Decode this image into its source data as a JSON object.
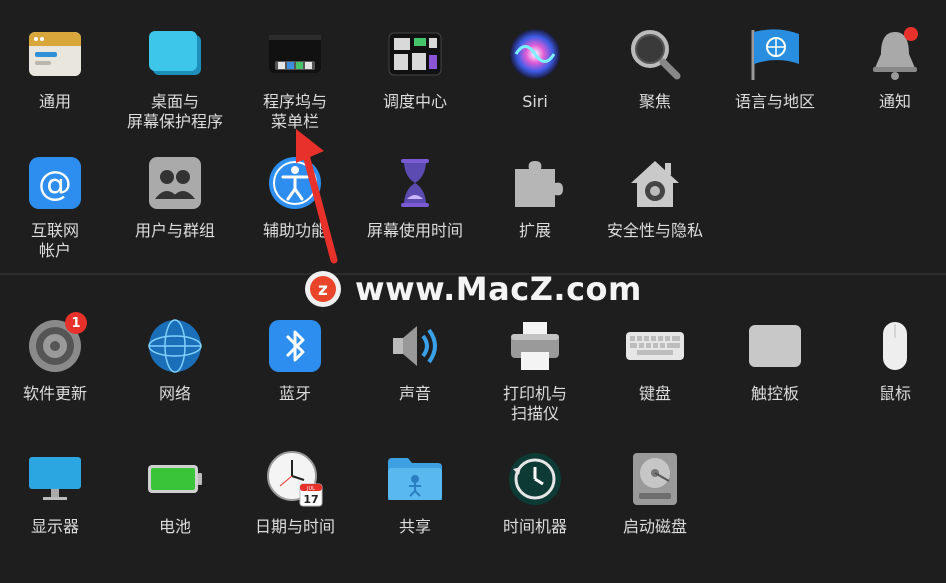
{
  "row1": [
    {
      "label": "通用",
      "icon": "general-icon"
    },
    {
      "label": "桌面与\n屏幕保护程序",
      "icon": "desktop-screensaver-icon"
    },
    {
      "label": "程序坞与\n菜单栏",
      "icon": "dock-menubar-icon"
    },
    {
      "label": "调度中心",
      "icon": "mission-control-icon"
    },
    {
      "label": "Siri",
      "icon": "siri-icon"
    },
    {
      "label": "聚焦",
      "icon": "spotlight-icon"
    },
    {
      "label": "语言与地区",
      "icon": "language-region-icon"
    },
    {
      "label": "通知",
      "icon": "notifications-icon"
    }
  ],
  "row2": [
    {
      "label": "互联网\n帐户",
      "icon": "internet-accounts-icon"
    },
    {
      "label": "用户与群组",
      "icon": "users-groups-icon"
    },
    {
      "label": "辅助功能",
      "icon": "accessibility-icon"
    },
    {
      "label": "屏幕使用时间",
      "icon": "screen-time-icon"
    },
    {
      "label": "扩展",
      "icon": "extensions-icon"
    },
    {
      "label": "安全性与隐私",
      "icon": "security-privacy-icon"
    }
  ],
  "row3": [
    {
      "label": "软件更新",
      "icon": "software-update-icon",
      "badge": "1"
    },
    {
      "label": "网络",
      "icon": "network-icon"
    },
    {
      "label": "蓝牙",
      "icon": "bluetooth-icon"
    },
    {
      "label": "声音",
      "icon": "sound-icon"
    },
    {
      "label": "打印机与\n扫描仪",
      "icon": "printers-scanners-icon"
    },
    {
      "label": "键盘",
      "icon": "keyboard-icon"
    },
    {
      "label": "触控板",
      "icon": "trackpad-icon"
    },
    {
      "label": "鼠标",
      "icon": "mouse-icon"
    }
  ],
  "row4": [
    {
      "label": "显示器",
      "icon": "displays-icon"
    },
    {
      "label": "电池",
      "icon": "battery-icon"
    },
    {
      "label": "日期与时间",
      "icon": "date-time-icon",
      "calendar_month": "JUL",
      "calendar_day": "17"
    },
    {
      "label": "共享",
      "icon": "sharing-icon"
    },
    {
      "label": "时间机器",
      "icon": "time-machine-icon"
    },
    {
      "label": "启动磁盘",
      "icon": "startup-disk-icon"
    }
  ],
  "watermark": {
    "text": "www.MacZ.com",
    "logo_letter": "z"
  },
  "colors": {
    "background": "#1e1e1f",
    "arrow": "#e8312a",
    "badge": "#e8312a"
  }
}
